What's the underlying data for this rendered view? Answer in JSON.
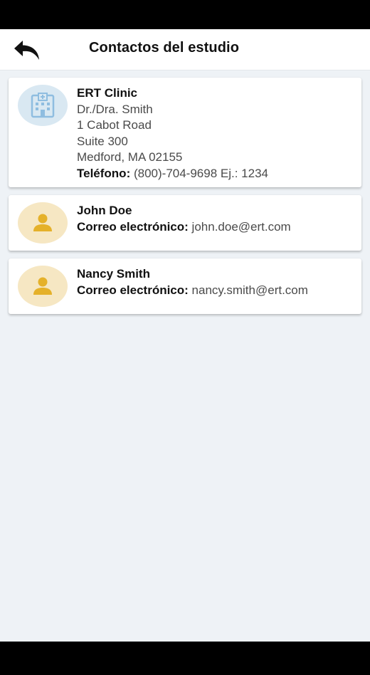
{
  "header": {
    "title": "Contactos del estudio"
  },
  "contacts": [
    {
      "name": "ERT Clinic",
      "lines": [
        "Dr./Dra. Smith",
        "1 Cabot Road",
        "Suite 300",
        "Medford, MA 02155"
      ],
      "phone_label": "Teléfono:",
      "phone_value": "(800)-704-9698 Ej.: 1234",
      "icon": "hospital-icon"
    },
    {
      "name": "John Doe",
      "email_label": "Correo electrónico:",
      "email_value": "john.doe@ert.com",
      "icon": "person-icon"
    },
    {
      "name": "Nancy Smith",
      "email_label": "Correo electrónico:",
      "email_value": "nancy.smith@ert.com",
      "icon": "person-icon"
    }
  ],
  "colors": {
    "background": "#eef2f6",
    "card": "#ffffff",
    "clinic_avatar_bg": "#d9e8f2",
    "clinic_icon": "#8fbde0",
    "person_avatar_bg": "#f6e7c3",
    "person_icon": "#e5b12a"
  }
}
